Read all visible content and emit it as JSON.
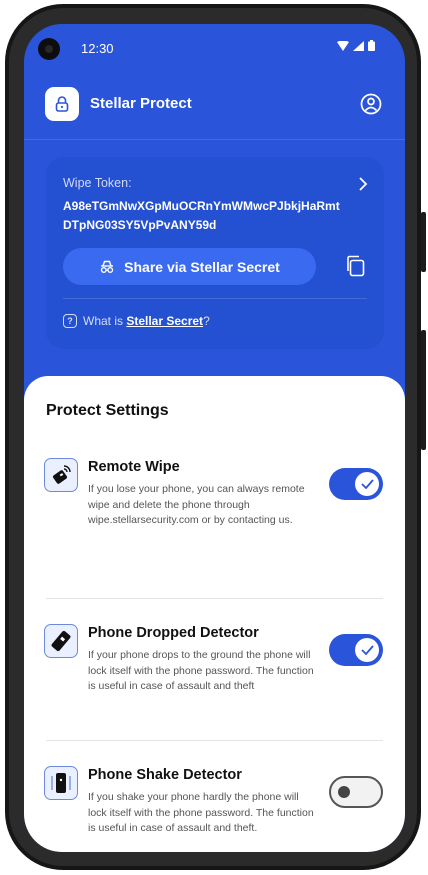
{
  "status_bar": {
    "time": "12:30"
  },
  "header": {
    "app_title": "Stellar Protect"
  },
  "token_card": {
    "label": "Wipe Token:",
    "value": "A98eTGmNwXGpMuOCRnYmWMwcPJbkjHaRmt DTpNG03SY5VpPvANY59d",
    "share_label": "Share via Stellar Secret",
    "whatis_prefix": "What is ",
    "whatis_link": "Stellar Secret",
    "whatis_suffix": "?"
  },
  "settings": {
    "title": "Protect Settings",
    "items": [
      {
        "title": "Remote Wipe",
        "description": "If you lose your phone, you can always remote wipe and delete the phone through wipe.stellarsecurity.com or by contacting us.",
        "enabled": true,
        "icon": "remote-wipe-icon"
      },
      {
        "title": "Phone Dropped Detector",
        "description": "If your phone drops to the ground the phone will lock itself with the phone password. The function is useful in case of assault and theft",
        "enabled": true,
        "icon": "phone-dropped-icon"
      },
      {
        "title": "Phone Shake Detector",
        "description": "If you shake your phone hardly the phone will lock itself with the phone password. The function is useful in case of assault and theft.",
        "enabled": false,
        "icon": "phone-shake-icon"
      }
    ]
  },
  "colors": {
    "primary": "#2a55da",
    "card": "#2450d2",
    "button": "#3a6af0",
    "sheet": "#ffffff"
  }
}
